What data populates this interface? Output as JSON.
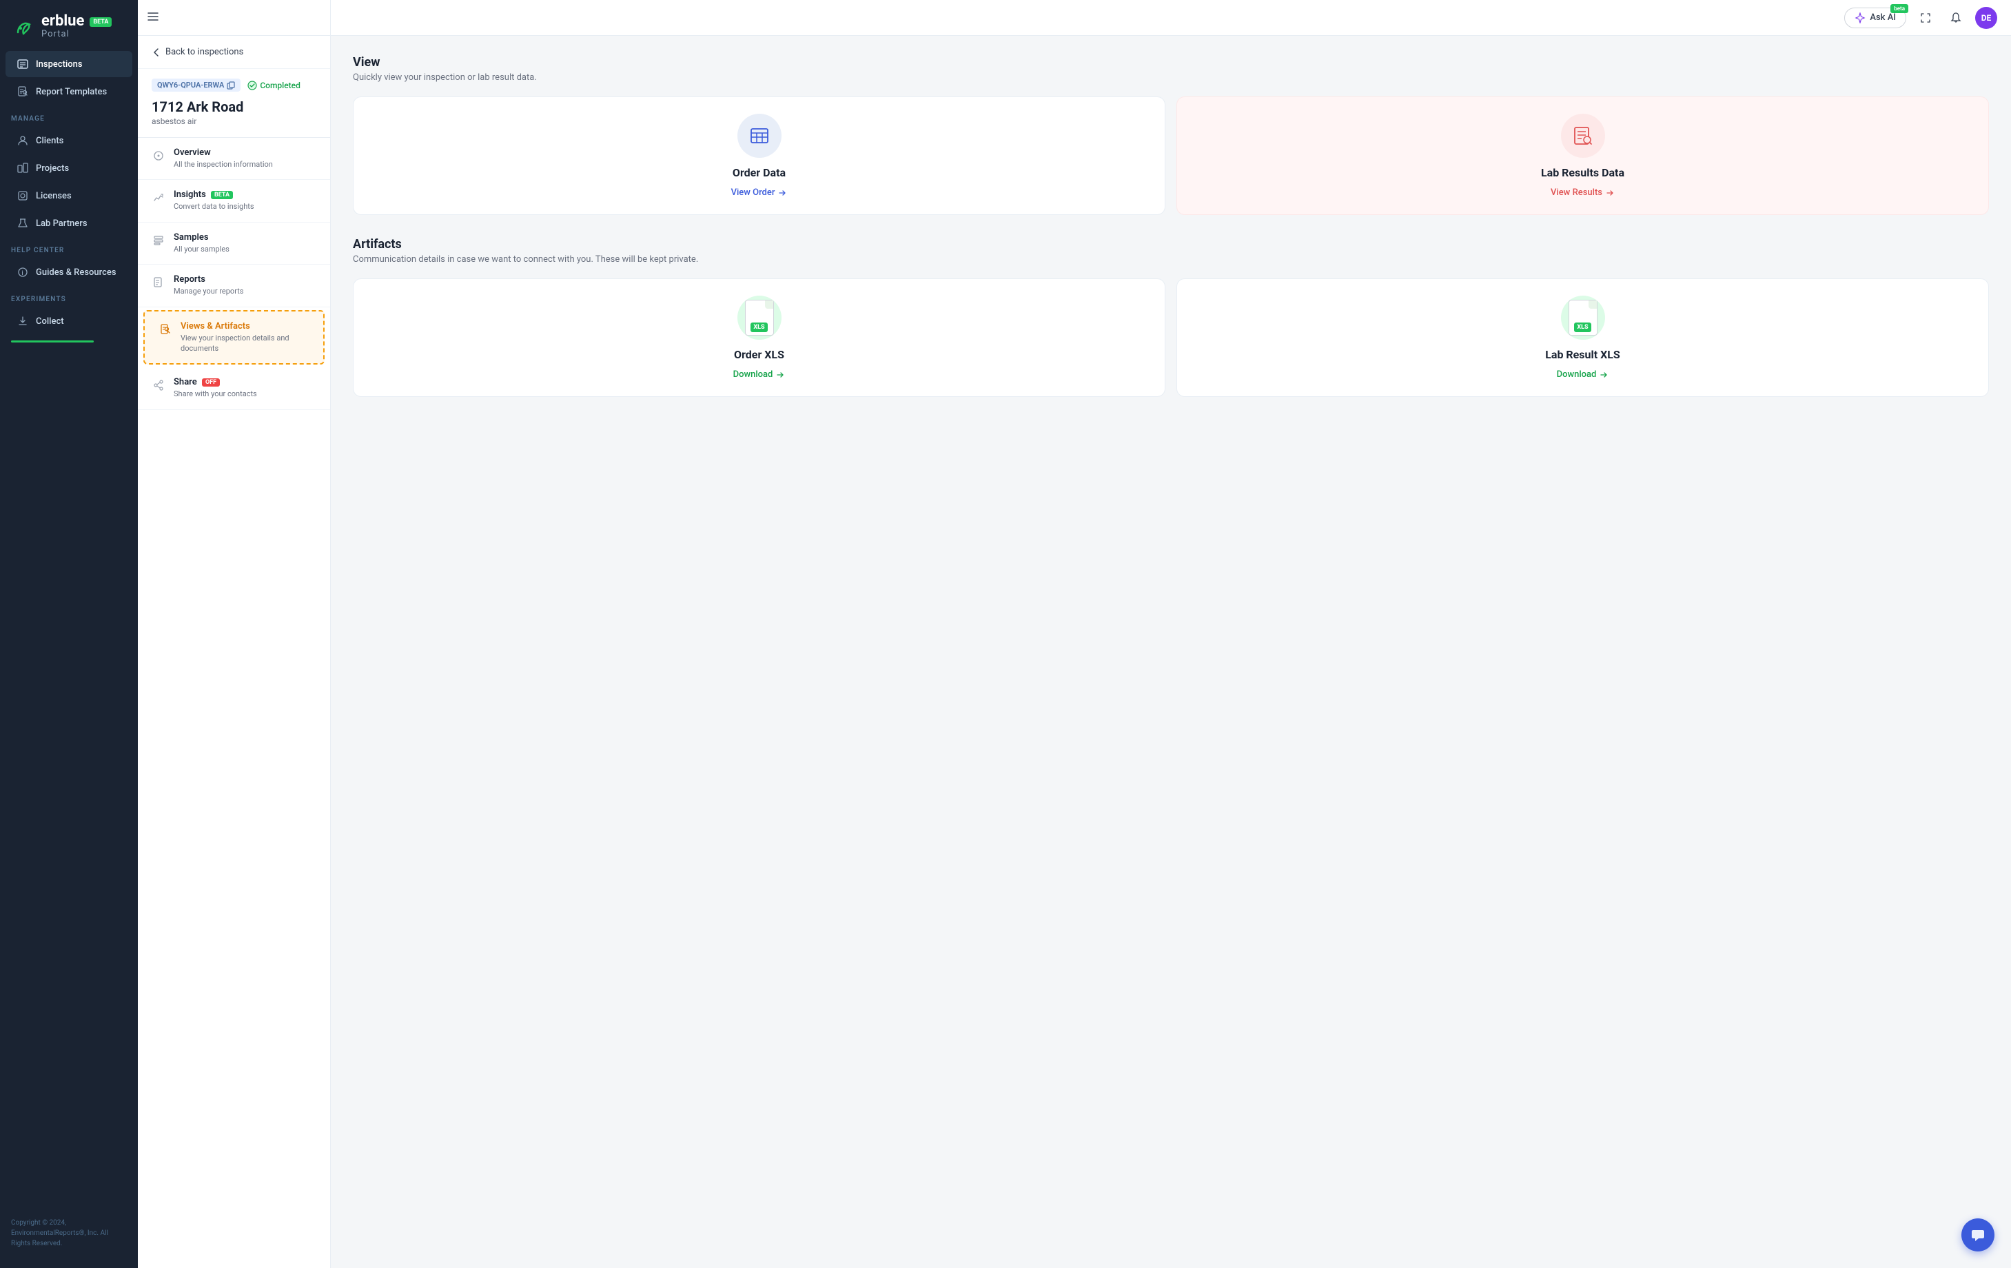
{
  "app": {
    "name": "erblue",
    "subtitle": "Portal",
    "beta": "BETA"
  },
  "header": {
    "ask_ai_label": "Ask AI",
    "ask_ai_beta": "beta",
    "user_initials": "DE"
  },
  "sidebar": {
    "sections": [
      {
        "items": [
          {
            "id": "inspections",
            "label": "Inspections",
            "active": true
          },
          {
            "id": "report-templates",
            "label": "Report Templates",
            "active": false
          }
        ]
      },
      {
        "label": "MANAGE",
        "items": [
          {
            "id": "clients",
            "label": "Clients"
          },
          {
            "id": "projects",
            "label": "Projects"
          },
          {
            "id": "licenses",
            "label": "Licenses"
          },
          {
            "id": "lab-partners",
            "label": "Lab Partners"
          }
        ]
      },
      {
        "label": "HELP CENTER",
        "items": [
          {
            "id": "guides",
            "label": "Guides & Resources"
          }
        ]
      },
      {
        "label": "EXPERIMENTS",
        "items": [
          {
            "id": "collect",
            "label": "Collect"
          }
        ]
      }
    ],
    "footer": "Copyright © 2024,\nEnvironmentalReports®, Inc. All Rights\nReserved."
  },
  "middle_panel": {
    "back_label": "Back to inspections",
    "inspection_id": "QWY6-QPUA-ERWA",
    "status": "Completed",
    "title": "1712 Ark Road",
    "subtitle": "asbestos air",
    "nav_items": [
      {
        "id": "overview",
        "title": "Overview",
        "subtitle": "All the inspection information",
        "active": false
      },
      {
        "id": "insights",
        "title": "Insights",
        "subtitle": "Convert data to insights",
        "beta": true,
        "active": false
      },
      {
        "id": "samples",
        "title": "Samples",
        "subtitle": "All your samples",
        "active": false
      },
      {
        "id": "reports",
        "title": "Reports",
        "subtitle": "Manage your reports",
        "active": false
      },
      {
        "id": "views-artifacts",
        "title": "Views & Artifacts",
        "subtitle": "View your inspection details and documents",
        "active": true
      },
      {
        "id": "share",
        "title": "Share",
        "subtitle": "Share with your contacts",
        "off": true,
        "active": false
      }
    ]
  },
  "content": {
    "view_section": {
      "title": "View",
      "subtitle": "Quickly view your inspection or lab result data.",
      "cards": [
        {
          "id": "order-data",
          "title": "Order Data",
          "link_label": "View Order",
          "link_color": "blue",
          "icon_color": "blue"
        },
        {
          "id": "lab-results-data",
          "title": "Lab Results Data",
          "link_label": "View Results",
          "link_color": "pink",
          "icon_color": "pink"
        }
      ]
    },
    "artifacts_section": {
      "title": "Artifacts",
      "subtitle": "Communication details in case we want to connect with you. These will be kept private.",
      "cards": [
        {
          "id": "order-xls",
          "title": "Order XLS",
          "link_label": "Download",
          "link_color": "green",
          "icon_color": "green",
          "file_type": "XLS"
        },
        {
          "id": "lab-result-xls",
          "title": "Lab Result XLS",
          "link_label": "Download",
          "link_color": "green",
          "icon_color": "green",
          "file_type": "XLS"
        }
      ]
    }
  }
}
